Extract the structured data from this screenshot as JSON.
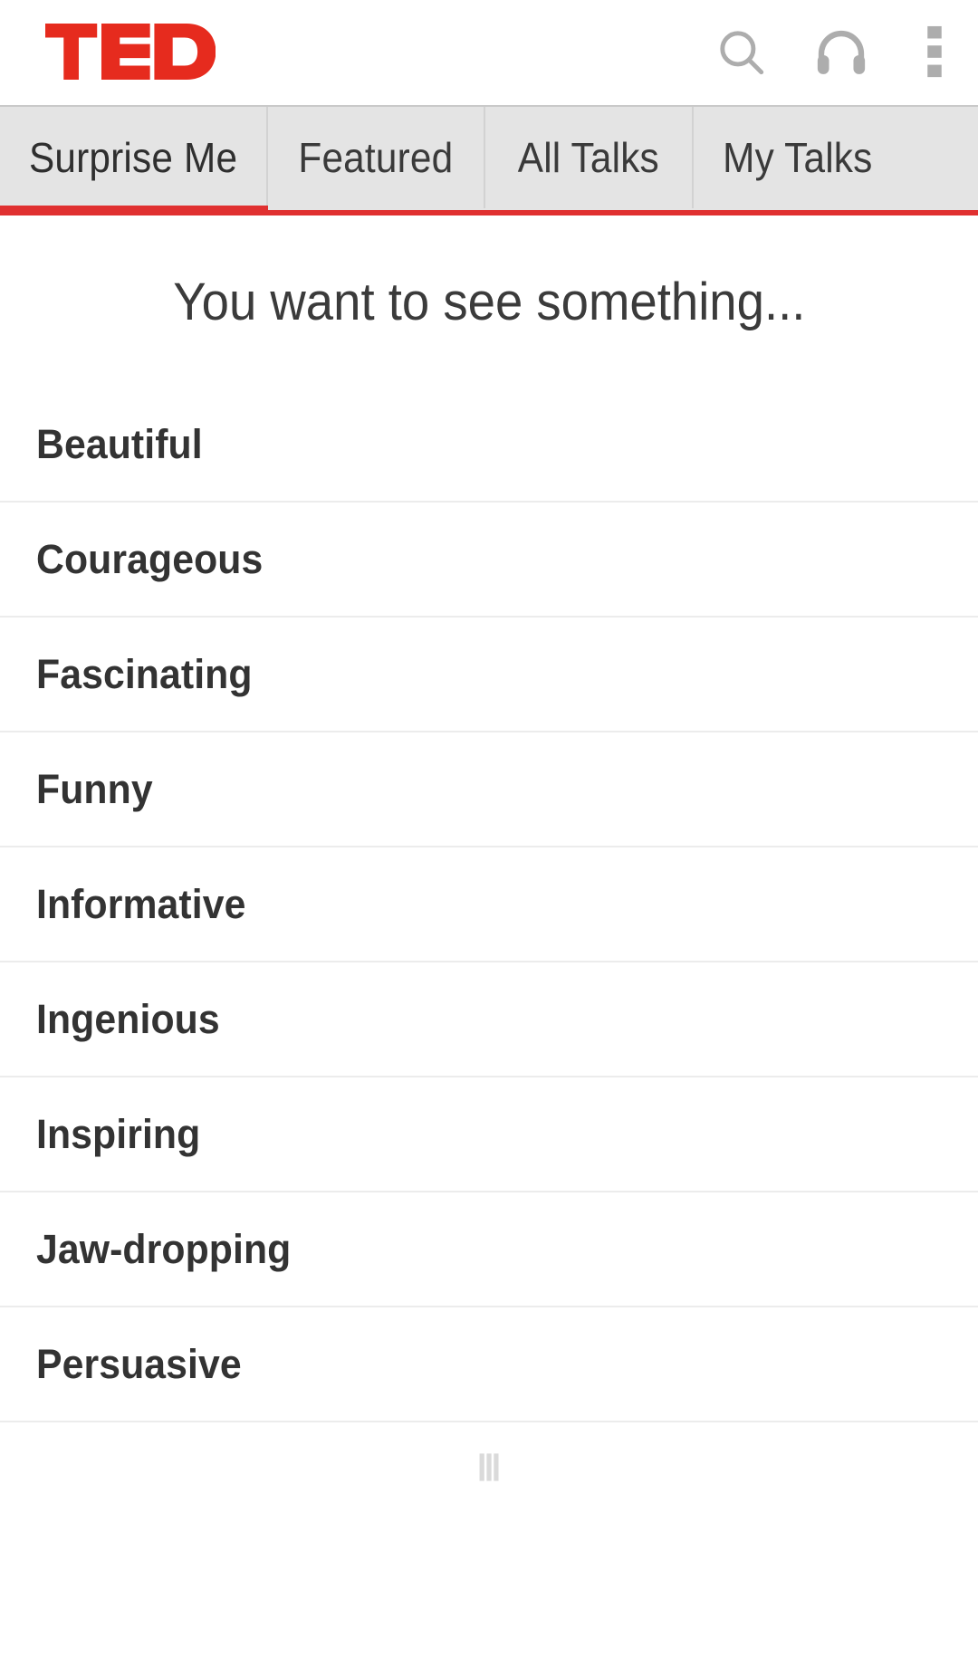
{
  "app": {
    "name": "TED",
    "logo_text": "TED",
    "brand_color": "#e62b1e",
    "accent_color": "#e03030"
  },
  "appbar": {
    "actions": [
      {
        "name": "search-icon",
        "label": "Search"
      },
      {
        "name": "headphones-icon",
        "label": "Listen"
      },
      {
        "name": "more-vert-icon",
        "label": "More options"
      }
    ]
  },
  "tabs": [
    {
      "label": "Surprise Me",
      "active": true
    },
    {
      "label": "Featured",
      "active": false
    },
    {
      "label": "All Talks",
      "active": false
    },
    {
      "label": "My Talks",
      "active": false
    }
  ],
  "main": {
    "heading": "You want to see something...",
    "moods": [
      {
        "label": "Beautiful"
      },
      {
        "label": "Courageous"
      },
      {
        "label": "Fascinating"
      },
      {
        "label": "Funny"
      },
      {
        "label": "Informative"
      },
      {
        "label": "Ingenious"
      },
      {
        "label": "Inspiring"
      },
      {
        "label": "Jaw-dropping"
      },
      {
        "label": "Persuasive"
      }
    ],
    "next_partial_label": "Ⅲ"
  }
}
